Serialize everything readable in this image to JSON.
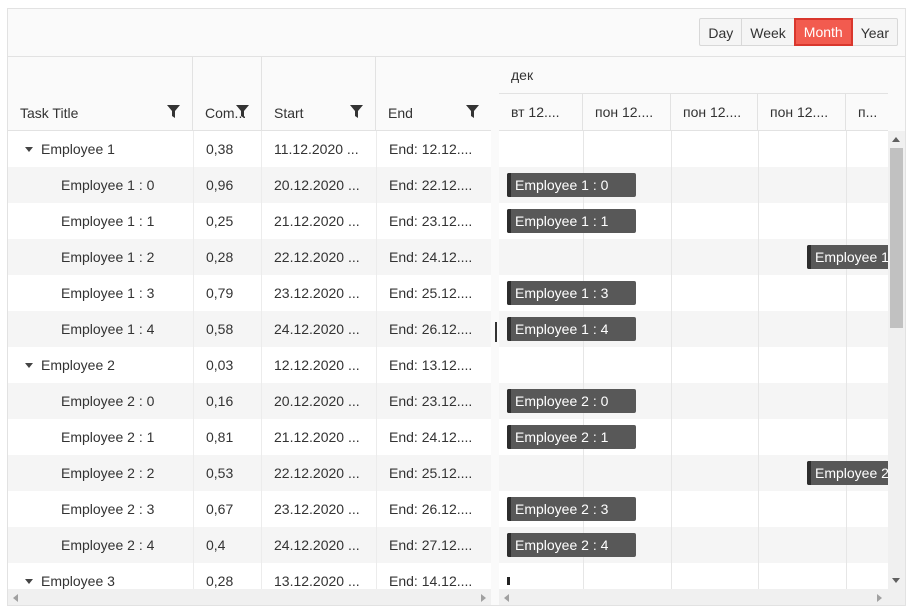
{
  "toolbar": {
    "views": [
      {
        "label": "Day",
        "active": false
      },
      {
        "label": "Week",
        "active": false
      },
      {
        "label": "Month",
        "active": true
      },
      {
        "label": "Year",
        "active": false
      }
    ]
  },
  "grid": {
    "columns": [
      {
        "label": "Task Title"
      },
      {
        "label": "Com..."
      },
      {
        "label": "Start"
      },
      {
        "label": "End"
      }
    ],
    "rows": [
      {
        "title": "Employee 1",
        "parent": true,
        "complete": "0,38",
        "start": "11.12.2020 ...",
        "end": "End: 12.12...."
      },
      {
        "title": "Employee 1 : 0",
        "parent": false,
        "complete": "0,96",
        "start": "20.12.2020 ...",
        "end": "End: 22.12...."
      },
      {
        "title": "Employee 1 : 1",
        "parent": false,
        "complete": "0,25",
        "start": "21.12.2020 ...",
        "end": "End: 23.12...."
      },
      {
        "title": "Employee 1 : 2",
        "parent": false,
        "complete": "0,28",
        "start": "22.12.2020 ...",
        "end": "End: 24.12...."
      },
      {
        "title": "Employee 1 : 3",
        "parent": false,
        "complete": "0,79",
        "start": "23.12.2020 ...",
        "end": "End: 25.12...."
      },
      {
        "title": "Employee 1 : 4",
        "parent": false,
        "complete": "0,58",
        "start": "24.12.2020 ...",
        "end": "End: 26.12...."
      },
      {
        "title": "Employee 2",
        "parent": true,
        "complete": "0,03",
        "start": "12.12.2020 ...",
        "end": "End: 13.12...."
      },
      {
        "title": "Employee 2 : 0",
        "parent": false,
        "complete": "0,16",
        "start": "20.12.2020 ...",
        "end": "End: 23.12...."
      },
      {
        "title": "Employee 2 : 1",
        "parent": false,
        "complete": "0,81",
        "start": "21.12.2020 ...",
        "end": "End: 24.12...."
      },
      {
        "title": "Employee 2 : 2",
        "parent": false,
        "complete": "0,53",
        "start": "22.12.2020 ...",
        "end": "End: 25.12...."
      },
      {
        "title": "Employee 2 : 3",
        "parent": false,
        "complete": "0,67",
        "start": "23.12.2020 ...",
        "end": "End: 26.12...."
      },
      {
        "title": "Employee 2 : 4",
        "parent": false,
        "complete": "0,4",
        "start": "24.12.2020 ...",
        "end": "End: 27.12...."
      },
      {
        "title": "Employee 3",
        "parent": true,
        "complete": "0,28",
        "start": "13.12.2020 ...",
        "end": "End: 14.12...."
      }
    ]
  },
  "timeline": {
    "month_label": "дек",
    "days": [
      "вт 12....",
      "пон 12....",
      "пон 12....",
      "пон 12....",
      "п..."
    ],
    "bars": [
      {
        "row": 1,
        "label": "Employee 1 : 0",
        "progress": 0.96
      },
      {
        "row": 2,
        "label": "Employee 1 : 1",
        "progress": 0.25
      },
      {
        "row": 3,
        "label": "Employee 1 : 2",
        "progress": 0.28
      },
      {
        "row": 4,
        "label": "Employee 1 : 3",
        "progress": 0.79
      },
      {
        "row": 5,
        "label": "Employee 1 : 4",
        "progress": 0.58
      },
      {
        "row": 7,
        "label": "Employee 2 : 0",
        "progress": 0.16
      },
      {
        "row": 8,
        "label": "Employee 2 : 1",
        "progress": 0.81
      },
      {
        "row": 9,
        "label": "Employee 2 : 2",
        "progress": 0.53
      },
      {
        "row": 10,
        "label": "Employee 2 : 3",
        "progress": 0.67
      },
      {
        "row": 11,
        "label": "Employee 2 : 4",
        "progress": 0.4
      }
    ]
  },
  "colors": {
    "active_view": "#f25b4f",
    "task_bar": "#585858",
    "task_progress": "#2d2d2d"
  }
}
